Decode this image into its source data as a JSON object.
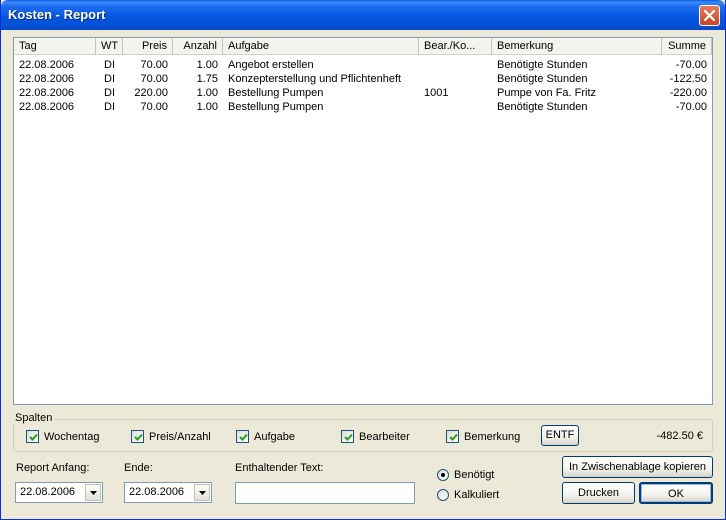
{
  "window": {
    "title": "Kosten - Report"
  },
  "report": {
    "columns": [
      "Tag",
      "WT",
      "Preis",
      "Anzahl",
      "Aufgabe",
      "Bear./Ko...",
      "Bemerkung",
      "Summe"
    ],
    "rows": [
      [
        "22.08.2006",
        "DI",
        "70.00",
        "1.00",
        "Angebot erstellen",
        "",
        "Benötigte Stunden",
        "-70.00"
      ],
      [
        "22.08.2006",
        "DI",
        "70.00",
        "1.75",
        "Konzepterstellung und Pflichtenheft",
        "",
        "Benötigte Stunden",
        "-122.50"
      ],
      [
        "22.08.2006",
        "DI",
        "220.00",
        "1.00",
        "Bestellung Pumpen",
        "1001",
        "Pumpe von Fa. Fritz",
        "-220.00"
      ],
      [
        "22.08.2006",
        "DI",
        "70.00",
        "1.00",
        "Bestellung Pumpen",
        "",
        "Benötigte Stunden",
        "-70.00"
      ]
    ]
  },
  "columns_group": {
    "legend": "Spalten",
    "checkboxes": [
      {
        "label": "Wochentag",
        "checked": true
      },
      {
        "label": "Preis/Anzahl",
        "checked": true
      },
      {
        "label": "Aufgabe",
        "checked": true
      },
      {
        "label": "Bearbeiter",
        "checked": true
      },
      {
        "label": "Bemerkung",
        "checked": true
      }
    ],
    "entf_label": "ENTF",
    "total": "-482.50 €"
  },
  "filters": {
    "start_label": "Report Anfang:",
    "start_value": "22.08.2006",
    "end_label": "Ende:",
    "end_value": "22.08.2006",
    "text_label": "Enthaltender Text:",
    "text_value": ""
  },
  "mode": {
    "options": [
      {
        "label": "Benötigt",
        "selected": true
      },
      {
        "label": "Kalkuliert",
        "selected": false
      }
    ]
  },
  "buttons": {
    "clipboard": "In Zwischenablage kopieren",
    "print": "Drucken",
    "ok": "OK"
  },
  "colors": {
    "titlebar": "#0557e0",
    "close_button": "#c94524",
    "window_bg": "#ece9d8"
  }
}
